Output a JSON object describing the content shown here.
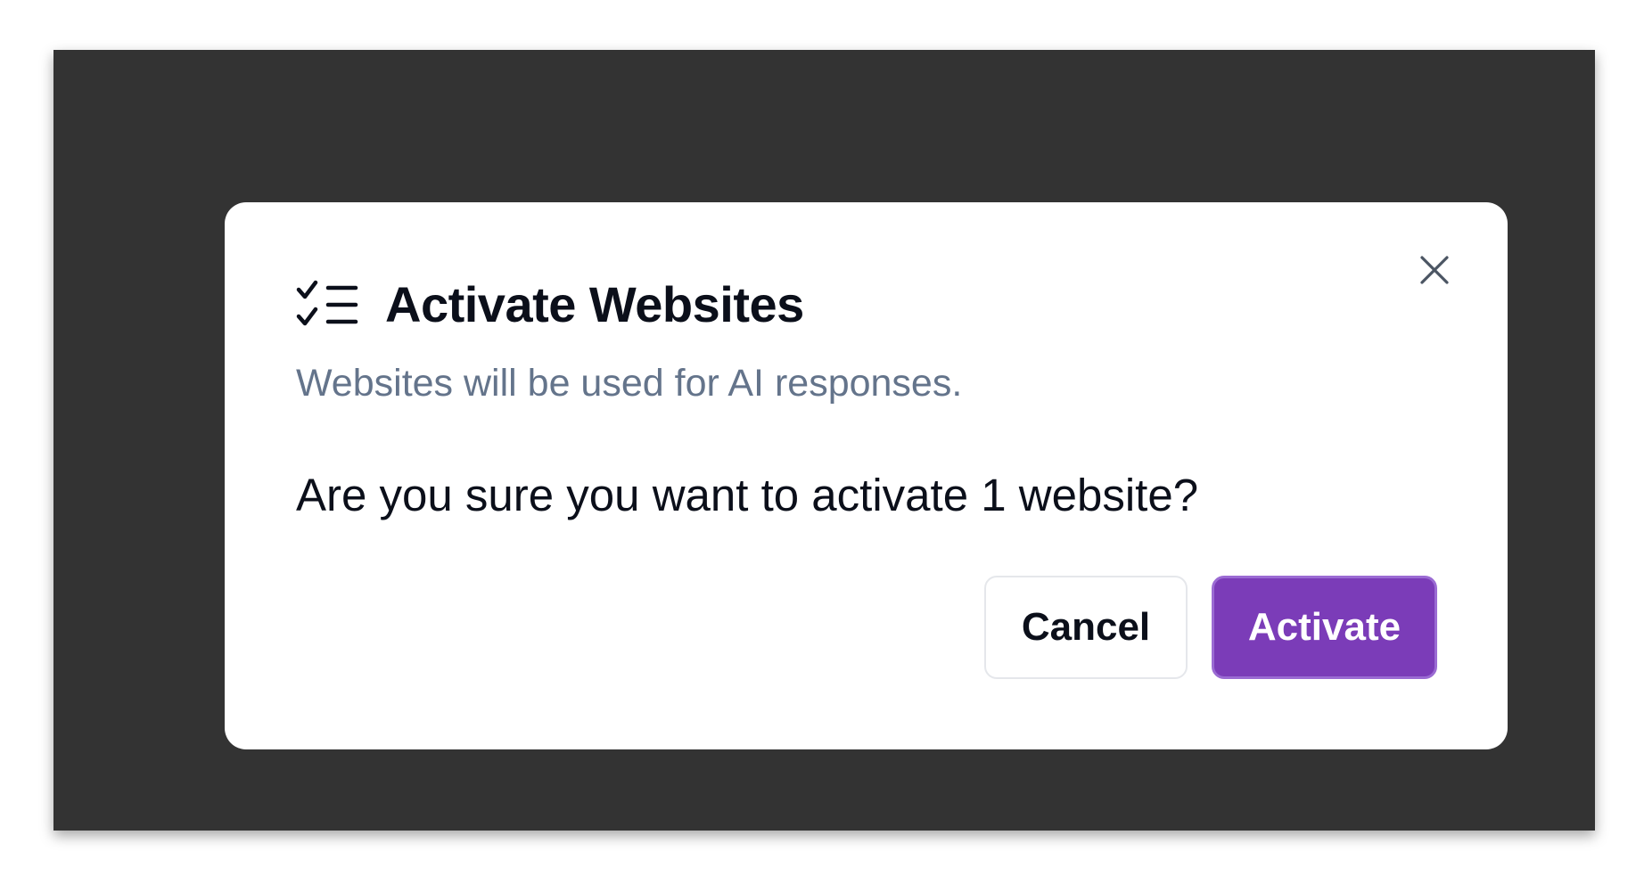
{
  "dialog": {
    "icon": "checklist-icon",
    "title": "Activate Websites",
    "subtitle": "Websites will be used for AI responses.",
    "message": "Are you sure you want to activate 1 website?",
    "close_icon": "close-icon",
    "cancel_label": "Cancel",
    "activate_label": "Activate"
  },
  "colors": {
    "backdrop": "#333333",
    "dialog_background": "#ffffff",
    "title_text": "#0b0f1a",
    "subtitle_text": "#64748b",
    "primary_button": "#7b3cb8",
    "primary_button_border": "#9b6bd3",
    "cancel_border": "#e5e7eb"
  }
}
